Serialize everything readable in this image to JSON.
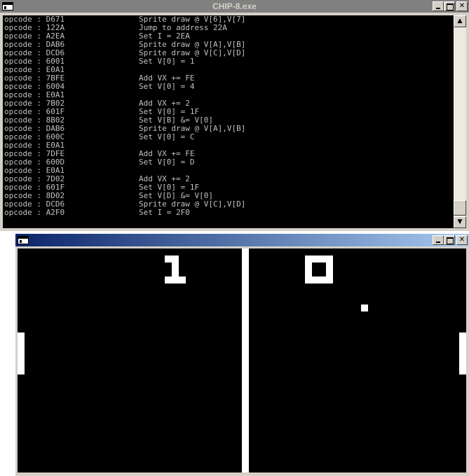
{
  "console": {
    "title": "CHIP-8.exe",
    "lines": [
      {
        "op": "opcode : D671",
        "desc": "Sprite draw @ V[6],V[7]"
      },
      {
        "op": "opcode : 122A",
        "desc": "Jump to address 22A"
      },
      {
        "op": "opcode : A2EA",
        "desc": "Set I = 2EA"
      },
      {
        "op": "opcode : DAB6",
        "desc": "Sprite draw @ V[A],V[B]"
      },
      {
        "op": "opcode : DCD6",
        "desc": "Sprite draw @ V[C],V[D]"
      },
      {
        "op": "opcode : 6001",
        "desc": "Set V[0] = 1"
      },
      {
        "op": "opcode : E0A1",
        "desc": ""
      },
      {
        "op": "opcode : 7BFE",
        "desc": "Add VX += FE"
      },
      {
        "op": "opcode : 6004",
        "desc": "Set V[0] = 4"
      },
      {
        "op": "opcode : E0A1",
        "desc": ""
      },
      {
        "op": "opcode : 7B02",
        "desc": "Add VX += 2"
      },
      {
        "op": "opcode : 601F",
        "desc": "Set V[0] = 1F"
      },
      {
        "op": "opcode : 8B02",
        "desc": "Set V[B] &= V[0]"
      },
      {
        "op": "opcode : DAB6",
        "desc": "Sprite draw @ V[A],V[B]"
      },
      {
        "op": "opcode : 600C",
        "desc": "Set V[0] = C"
      },
      {
        "op": "opcode : E0A1",
        "desc": ""
      },
      {
        "op": "opcode : 7DFE",
        "desc": "Add VX += FE"
      },
      {
        "op": "opcode : 600D",
        "desc": "Set V[0] = D"
      },
      {
        "op": "opcode : E0A1",
        "desc": ""
      },
      {
        "op": "opcode : 7D02",
        "desc": "Add VX += 2"
      },
      {
        "op": "opcode : 601F",
        "desc": "Set V[0] = 1F"
      },
      {
        "op": "opcode : 8D02",
        "desc": "Set V[D] &= V[0]"
      },
      {
        "op": "opcode : DCD6",
        "desc": "Sprite draw @ V[C],V[D]"
      },
      {
        "op": "opcode : A2F0",
        "desc": "Set I = 2F0"
      }
    ],
    "scroll_up_icon": "▲",
    "scroll_down_icon": "▼"
  },
  "game": {
    "title": "",
    "score_left": "1",
    "score_right": "0"
  },
  "window_buttons": {
    "close": "✕"
  },
  "colors": {
    "console_bg": "#000000",
    "console_text": "#c0c0c0",
    "inactive_title": "#808080",
    "active_title_start": "#0a246a",
    "active_title_end": "#a6caf0",
    "pixel": "#ffffff"
  }
}
